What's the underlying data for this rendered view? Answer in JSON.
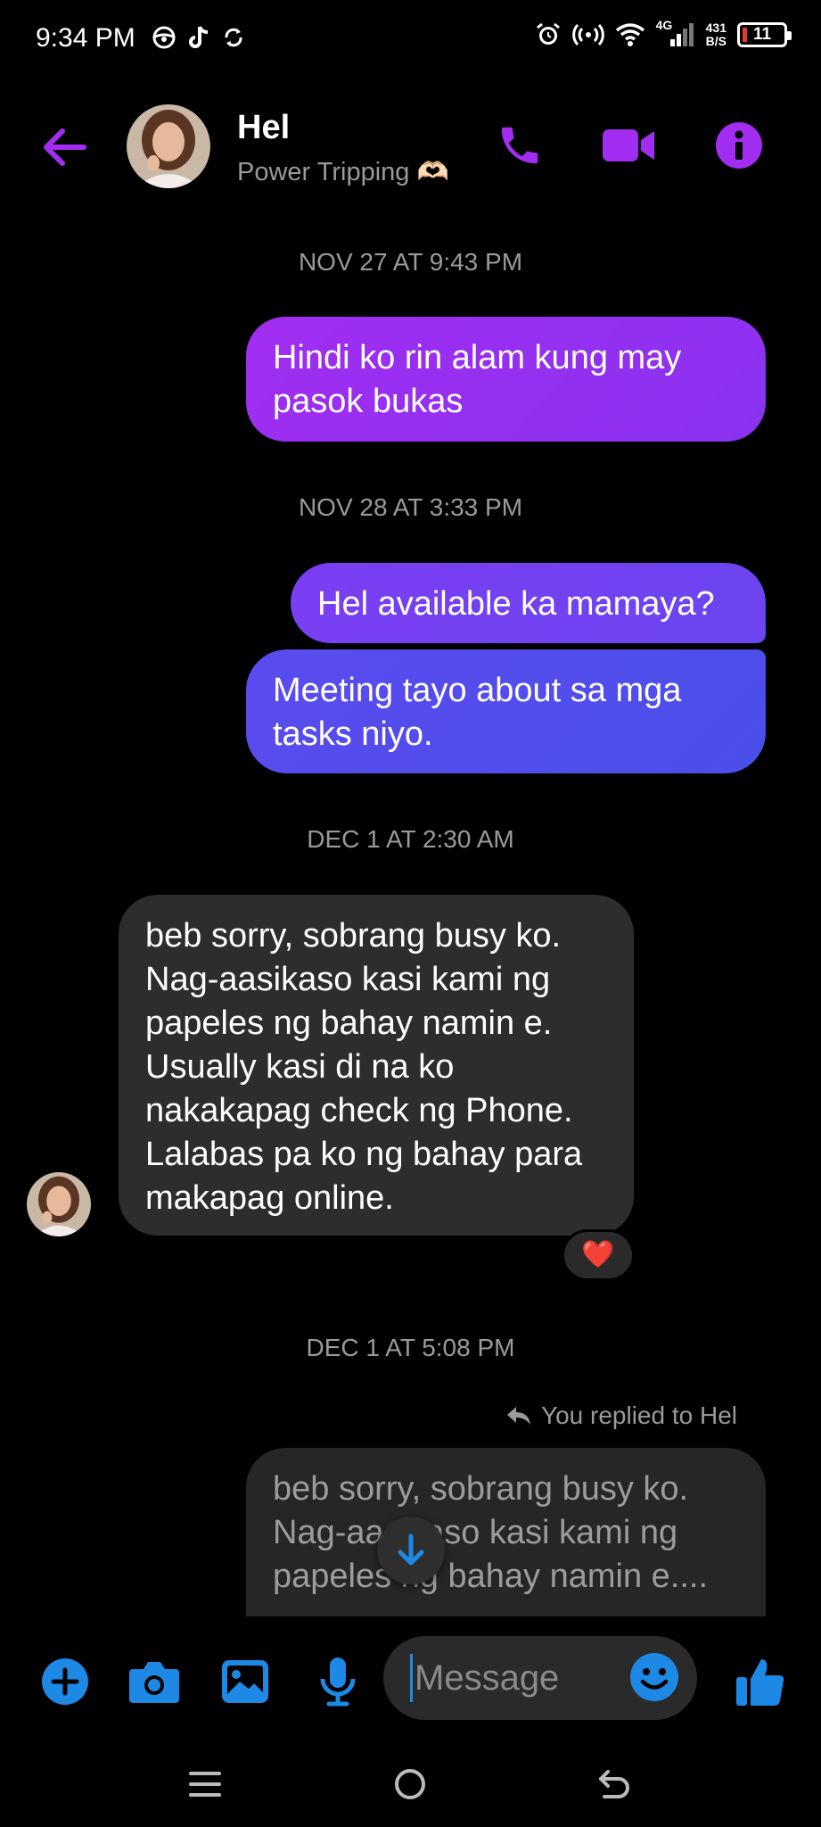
{
  "status_bar": {
    "time": "9:34 PM",
    "network": "4G",
    "speed_top": "431",
    "speed_bottom": "B/S",
    "battery": "11"
  },
  "header": {
    "contact_name": "Hel",
    "contact_status": "Power Tripping 🫶🏻"
  },
  "messages": {
    "ts1": "NOV 27 AT 9:43 PM",
    "m1": "Hindi ko rin alam kung may pasok bukas",
    "ts2": "NOV 28 AT 3:33 PM",
    "m2": "Hel available ka mamaya?",
    "m3": "Meeting tayo about sa mga tasks niyo.",
    "ts3": "DEC 1 AT 2:30 AM",
    "m4": "beb sorry, sobrang busy ko. Nag-aasikaso kasi kami ng papeles ng bahay namin e. Usually kasi di na ko nakakapag check ng Phone. Lalabas pa ko ng bahay para makapag online.",
    "reaction": "❤️",
    "ts4": "DEC 1 AT 5:08 PM",
    "replied_label": "You replied to Hel",
    "m5_quote": "beb sorry, sobrang busy ko. Nag-aasikaso kasi kami ng papeles ng bahay namin e...."
  },
  "composer": {
    "placeholder": "Message"
  },
  "colors": {
    "accent_purple": "#a12df0",
    "accent_blue": "#1e88e5",
    "bubble_incoming": "#2d2d2d"
  }
}
